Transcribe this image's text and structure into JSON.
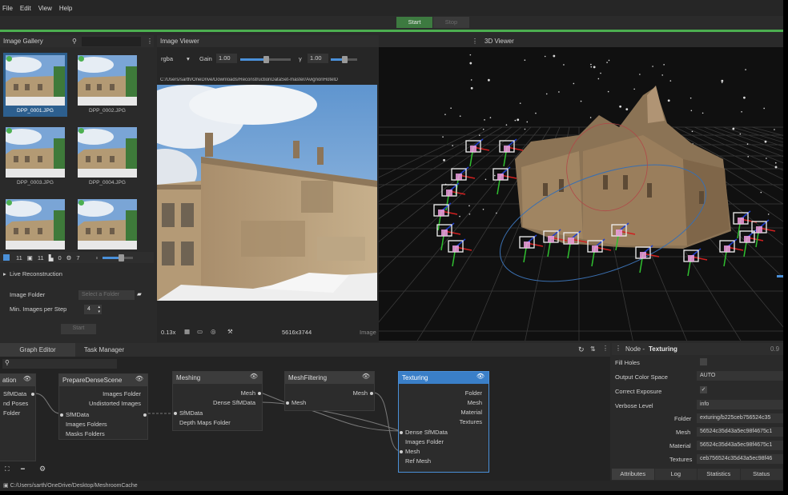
{
  "menu": [
    "File",
    "Edit",
    "View",
    "Help"
  ],
  "toolbar": {
    "start": "Start",
    "stop": "Stop"
  },
  "gallery": {
    "title": "Image Gallery",
    "thumbnails": [
      "DPP_0001.JPG",
      "DPP_0002.JPG",
      "DPP_0003.JPG",
      "DPP_0004.JPG",
      "",
      ""
    ],
    "stats": {
      "images": "11",
      "cameras": "11",
      "rejected": "0",
      "other": "7"
    }
  },
  "live": {
    "title": "Live Reconstruction",
    "folder_label": "Image Folder",
    "folder_placeholder": "Select a Folder",
    "min_label": "Min. Images per Step",
    "min_value": "4",
    "start": "Start"
  },
  "viewer": {
    "title": "Image Viewer",
    "channel": "rgba",
    "gain_label": "Gain",
    "gain_value": "1.00",
    "gamma_label": "γ",
    "gamma_value": "1.00",
    "gain_fraction": 0.5,
    "gamma_fraction": 0.5,
    "path": "C:/Users/sarth/OneDrive/Downloads/ReconstructionDataSet-master/AvignonHotelD",
    "zoom": "0.13x",
    "resolution": "5616x3744",
    "extra": "Image"
  },
  "viewer3d": {
    "title": "3D Viewer"
  },
  "graph": {
    "tabs": [
      "Graph Editor",
      "Task Manager"
    ],
    "nodes": {
      "n0": {
        "title": "ation",
        "outs": [
          "SfMData",
          "nd Poses",
          "Folder"
        ]
      },
      "prep": {
        "title": "PrepareDenseScene",
        "outs": [
          "Images Folder",
          "Undistorted Images"
        ],
        "ins": [
          "SfMData",
          "Images Folders",
          "Masks Folders"
        ]
      },
      "mesh": {
        "title": "Meshing",
        "outs": [
          "Mesh",
          "Dense SfMData"
        ],
        "ins": [
          "SfMData",
          "Depth Maps Folder"
        ]
      },
      "filt": {
        "title": "MeshFiltering",
        "outs": [
          "Mesh"
        ],
        "ins": [
          "Mesh"
        ]
      },
      "tex": {
        "title": "Texturing",
        "outs": [
          "Folder",
          "Mesh",
          "Material",
          "Textures"
        ],
        "ins": [
          "Dense SfMData",
          "Images Folder",
          "Mesh",
          "Ref Mesh"
        ]
      }
    }
  },
  "node_panel": {
    "title_prefix": "Node - ",
    "title": "Texturing",
    "version": "0.9",
    "fill_holes": "Fill Holes",
    "out_color_label": "Output Color Space",
    "out_color_value": "AUTO",
    "correct_exp": "Correct Exposure",
    "check": "✓",
    "verbose_label": "Verbose Level",
    "verbose_value": "info",
    "folder_label": "Folder",
    "folder_value": "exturing/b225ceb756524c35",
    "mesh_label": "Mesh",
    "mesh_value": "56524c35d43a5ec98f4675c1",
    "material_label": "Material",
    "material_value": "56524c35d43a5ec98f4675c1",
    "textures_label": "Textures",
    "textures_value": "ceb756524c35d43a5ec98f46",
    "tabs": [
      "Attributes",
      "Log",
      "Statistics",
      "Status"
    ]
  },
  "status": "C:/Users/sarth/OneDrive/Desktop/MeshroomCache",
  "colors": {
    "accent": "#4caf50",
    "selection": "#2d5f8e",
    "node_active": "#3a7fc8"
  }
}
